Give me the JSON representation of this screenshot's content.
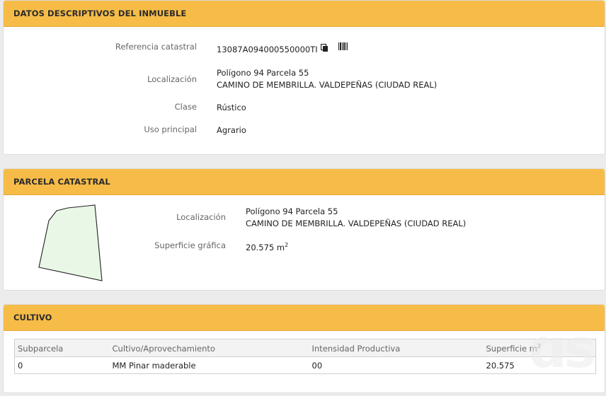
{
  "inmueble": {
    "header": "DATOS DESCRIPTIVOS DEL INMUEBLE",
    "ref_label": "Referencia catastral",
    "ref_value": "13087A094000550000TI",
    "loc_label": "Localización",
    "loc_line1": "Polígono 94 Parcela 55",
    "loc_line2": "CAMINO DE MEMBRILLA. VALDEPEÑAS (CIUDAD REAL)",
    "clase_label": "Clase",
    "clase_value": "Rústico",
    "uso_label": "Uso principal",
    "uso_value": "Agrario"
  },
  "parcela": {
    "header": "PARCELA CATASTRAL",
    "loc_label": "Localización",
    "loc_line1": "Polígono 94 Parcela 55",
    "loc_line2": "CAMINO DE MEMBRILLA. VALDEPEÑAS (CIUDAD REAL)",
    "sup_label": "Superficie gráfica",
    "sup_value": "20.575 m",
    "sup_exp": "2",
    "shape_fill": "#e9f8e6",
    "shape_stroke": "#222222"
  },
  "cultivo": {
    "header": "CULTIVO",
    "columns": [
      "Subparcela",
      "Cultivo/Aprovechamiento",
      "Intensidad Productiva",
      "Superficie m"
    ],
    "col_exp": "2",
    "rows": [
      [
        "0",
        "MM Pinar maderable",
        "00",
        "20.575"
      ]
    ]
  },
  "colors": {
    "header_bg": "#f6bc47",
    "panel_bg": "#ffffff",
    "page_bg": "#ececec"
  }
}
